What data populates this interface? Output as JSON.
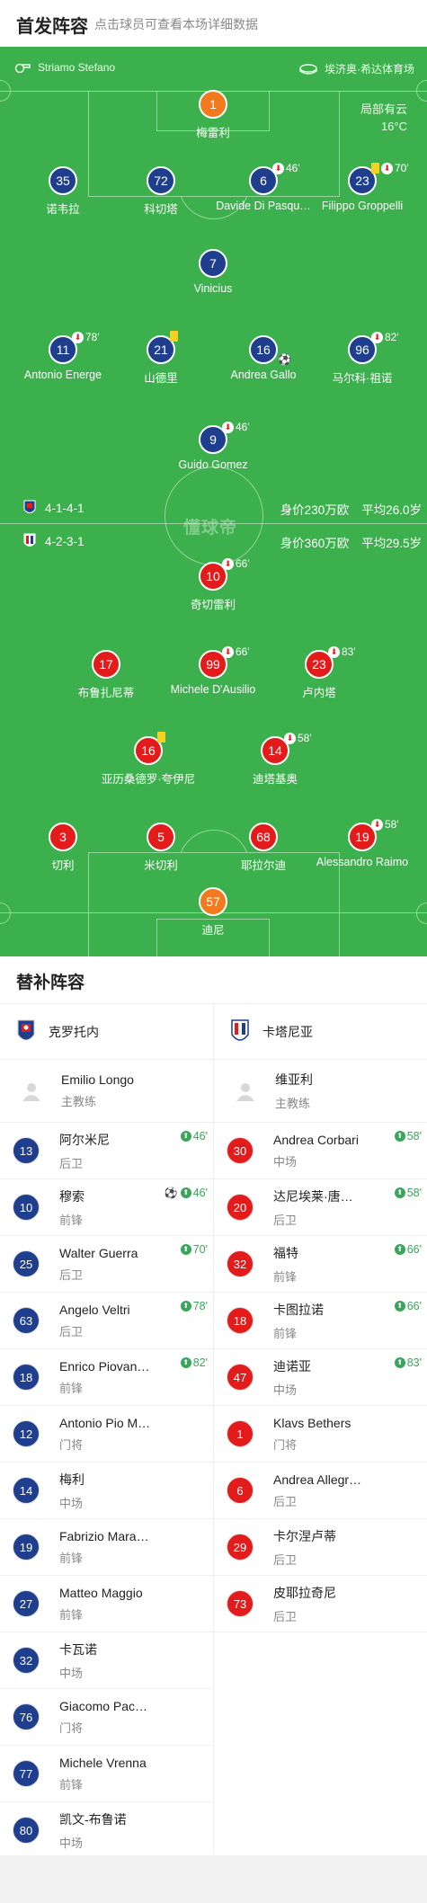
{
  "header": {
    "title": "首发阵容",
    "subtitle": "点击球员可查看本场详细数据"
  },
  "pitch": {
    "referee": "Striamo Stefano",
    "stadium": "埃济奥·希达体育场",
    "weather": "局部有云",
    "temperature": "16°C",
    "watermark": "懂球帝",
    "home_team": {
      "formation": "4-1-4-1",
      "value": "身价230万欧",
      "avg_age": "平均26.0岁"
    },
    "away_team": {
      "formation": "4-2-3-1",
      "value": "身价360万欧",
      "avg_age": "平均29.5岁"
    }
  },
  "home_players": [
    {
      "num": "1",
      "name": "梅雷利",
      "color": "orange",
      "sub": "",
      "yellow": false,
      "goal": false
    },
    {
      "num": "35",
      "name": "诺韦拉",
      "color": "blue",
      "sub": "",
      "yellow": false,
      "goal": false
    },
    {
      "num": "72",
      "name": "科切塔",
      "color": "blue",
      "sub": "",
      "yellow": false,
      "goal": false
    },
    {
      "num": "6",
      "name": "Davide Di Pasqu…",
      "color": "blue",
      "sub": "46'",
      "yellow": false,
      "goal": false
    },
    {
      "num": "23",
      "name": "Filippo Groppelli",
      "color": "blue",
      "sub": "70'",
      "yellow": true,
      "goal": false
    },
    {
      "num": "7",
      "name": "Vinicius",
      "color": "blue",
      "sub": "",
      "yellow": false,
      "goal": false
    },
    {
      "num": "11",
      "name": "Antonio Energe",
      "color": "blue",
      "sub": "78'",
      "yellow": false,
      "goal": false
    },
    {
      "num": "21",
      "name": "山德里",
      "color": "blue",
      "sub": "",
      "yellow": true,
      "goal": false
    },
    {
      "num": "16",
      "name": "Andrea Gallo",
      "color": "blue",
      "sub": "",
      "yellow": false,
      "goal": true
    },
    {
      "num": "96",
      "name": "马尔科·祖诺",
      "color": "blue",
      "sub": "82'",
      "yellow": false,
      "goal": false
    },
    {
      "num": "9",
      "name": "Guido Gomez",
      "color": "blue",
      "sub": "46'",
      "yellow": false,
      "goal": false
    }
  ],
  "away_players": [
    {
      "num": "10",
      "name": "奇切雷利",
      "color": "red",
      "sub": "66'",
      "yellow": false,
      "goal": false
    },
    {
      "num": "17",
      "name": "布鲁扎尼蒂",
      "color": "red",
      "sub": "",
      "yellow": false,
      "goal": false
    },
    {
      "num": "99",
      "name": "Michele D'Ausilio",
      "color": "red",
      "sub": "66'",
      "yellow": false,
      "goal": false
    },
    {
      "num": "23",
      "name": "卢内塔",
      "color": "red",
      "sub": "83'",
      "yellow": false,
      "goal": false
    },
    {
      "num": "16",
      "name": "亚历桑德罗·夸伊尼",
      "color": "red",
      "sub": "",
      "yellow": true,
      "goal": false
    },
    {
      "num": "14",
      "name": "迪塔基奥",
      "color": "red",
      "sub": "58'",
      "yellow": false,
      "goal": false
    },
    {
      "num": "3",
      "name": "切利",
      "color": "red",
      "sub": "",
      "yellow": false,
      "goal": false
    },
    {
      "num": "5",
      "name": "米切利",
      "color": "red",
      "sub": "",
      "yellow": false,
      "goal": false
    },
    {
      "num": "68",
      "name": "耶拉尔迪",
      "color": "red",
      "sub": "",
      "yellow": false,
      "goal": false
    },
    {
      "num": "19",
      "name": "Alessandro Raimo",
      "color": "red",
      "sub": "58'",
      "yellow": false,
      "goal": false
    },
    {
      "num": "57",
      "name": "迪尼",
      "color": "orange",
      "sub": "",
      "yellow": false,
      "goal": false
    }
  ],
  "subs": {
    "title": "替补阵容",
    "home": {
      "team_name": "克罗托内",
      "coach_name": "Emilio Longo",
      "coach_role": "主教练",
      "players": [
        {
          "num": "13",
          "name": "阿尔米尼",
          "role": "后卫",
          "in": "46'",
          "goal": false
        },
        {
          "num": "10",
          "name": "穆索",
          "role": "前锋",
          "in": "46'",
          "goal": true
        },
        {
          "num": "25",
          "name": "Walter Guerra",
          "role": "后卫",
          "in": "70'",
          "goal": false
        },
        {
          "num": "63",
          "name": "Angelo Veltri",
          "role": "后卫",
          "in": "78'",
          "goal": false
        },
        {
          "num": "18",
          "name": "Enrico Piovan…",
          "role": "前锋",
          "in": "82'",
          "goal": false
        },
        {
          "num": "12",
          "name": "Antonio Pio M…",
          "role": "门将",
          "in": "",
          "goal": false
        },
        {
          "num": "14",
          "name": "梅利",
          "role": "中场",
          "in": "",
          "goal": false
        },
        {
          "num": "19",
          "name": "Fabrizio Mara…",
          "role": "前锋",
          "in": "",
          "goal": false
        },
        {
          "num": "27",
          "name": "Matteo Maggio",
          "role": "前锋",
          "in": "",
          "goal": false
        },
        {
          "num": "32",
          "name": "卡瓦诺",
          "role": "中场",
          "in": "",
          "goal": false
        },
        {
          "num": "76",
          "name": "Giacomo Pac…",
          "role": "门将",
          "in": "",
          "goal": false
        },
        {
          "num": "77",
          "name": "Michele Vrenna",
          "role": "前锋",
          "in": "",
          "goal": false
        },
        {
          "num": "80",
          "name": "凯文-布鲁诺",
          "role": "中场",
          "in": "",
          "goal": false
        }
      ]
    },
    "away": {
      "team_name": "卡塔尼亚",
      "coach_name": "维亚利",
      "coach_role": "主教练",
      "players": [
        {
          "num": "30",
          "name": "Andrea Corbari",
          "role": "中场",
          "in": "58'",
          "goal": false
        },
        {
          "num": "20",
          "name": "达尼埃莱·唐…",
          "role": "后卫",
          "in": "58'",
          "goal": false
        },
        {
          "num": "32",
          "name": "福特",
          "role": "前锋",
          "in": "66'",
          "goal": false
        },
        {
          "num": "18",
          "name": "卡图拉诺",
          "role": "前锋",
          "in": "66'",
          "goal": false
        },
        {
          "num": "47",
          "name": "迪诺亚",
          "role": "中场",
          "in": "83'",
          "goal": false
        },
        {
          "num": "1",
          "name": "Klavs Bethers",
          "role": "门将",
          "in": "",
          "goal": false
        },
        {
          "num": "6",
          "name": "Andrea Allegr…",
          "role": "后卫",
          "in": "",
          "goal": false
        },
        {
          "num": "29",
          "name": "卡尔涅卢蒂",
          "role": "后卫",
          "in": "",
          "goal": false
        },
        {
          "num": "73",
          "name": "皮耶拉奇尼",
          "role": "后卫",
          "in": "",
          "goal": false
        }
      ]
    }
  },
  "colors": {
    "pitch": "#3cb04c",
    "home": "#1f3f8e",
    "away": "#e31b1b",
    "keeper": "#f07a1c",
    "sub_in": "#3aa65a",
    "yellow": "#f5d220"
  }
}
